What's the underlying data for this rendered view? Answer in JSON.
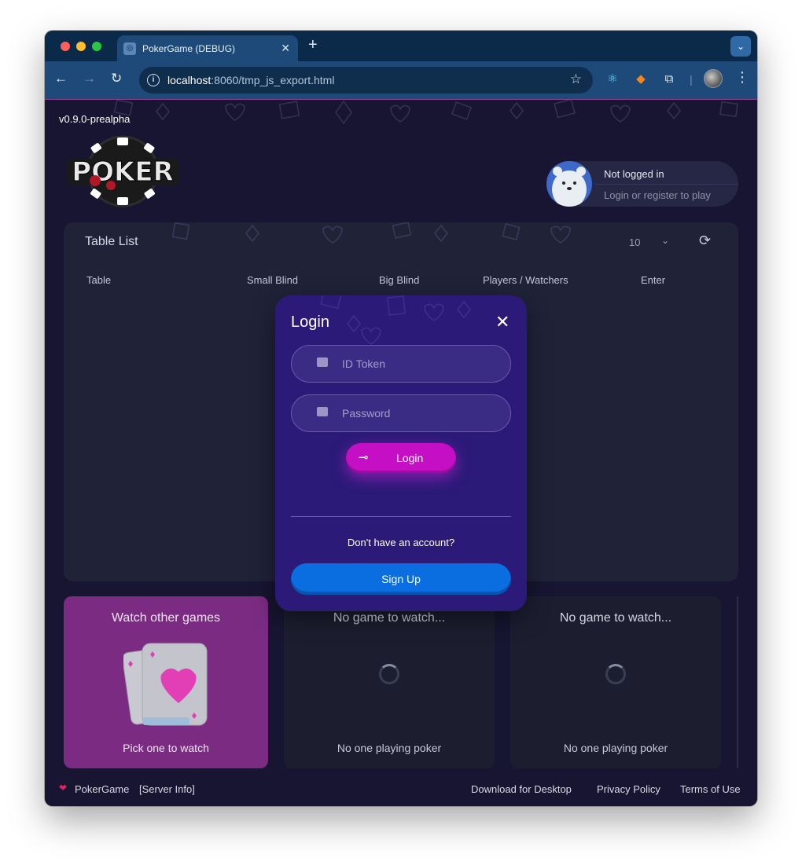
{
  "browser": {
    "tab_title": "PokerGame (DEBUG)",
    "tab_close": "✕",
    "new_tab": "+",
    "url_host": "localhost",
    "url_path": ":8060/tmp_js_export.html"
  },
  "app": {
    "version": "v0.9.0-prealpha",
    "logo_text": "POKER"
  },
  "user": {
    "status": "Not logged in",
    "hint": "Login or register to play"
  },
  "table_list": {
    "title": "Table List",
    "page_size": "10",
    "columns": [
      "Table",
      "Small Blind",
      "Big Blind",
      "Players / Watchers",
      "Enter"
    ]
  },
  "login_modal": {
    "title": "Login",
    "close": "✕",
    "id_placeholder": "ID Token",
    "password_placeholder": "Password",
    "login_label": "Login",
    "no_account": "Don't have an account?",
    "signup_label": "Sign Up"
  },
  "watch": {
    "main_title": "Watch other games",
    "main_sub": "Pick one to watch",
    "slots": [
      {
        "title": "No game to watch...",
        "sub": "No one playing poker"
      },
      {
        "title": "No game to watch...",
        "sub": "No one playing poker"
      }
    ]
  },
  "footer": {
    "brand": "PokerGame",
    "server_info": "[Server Info]",
    "download": "Download for Desktop",
    "privacy": "Privacy Policy",
    "terms": "Terms of Use"
  },
  "colors": {
    "page_bg": "#171531",
    "modal_bg": "#2b1a78",
    "login_button": "#c40fc4",
    "signup_button": "#0a6ee0",
    "watch_card": "#7b2c82"
  }
}
